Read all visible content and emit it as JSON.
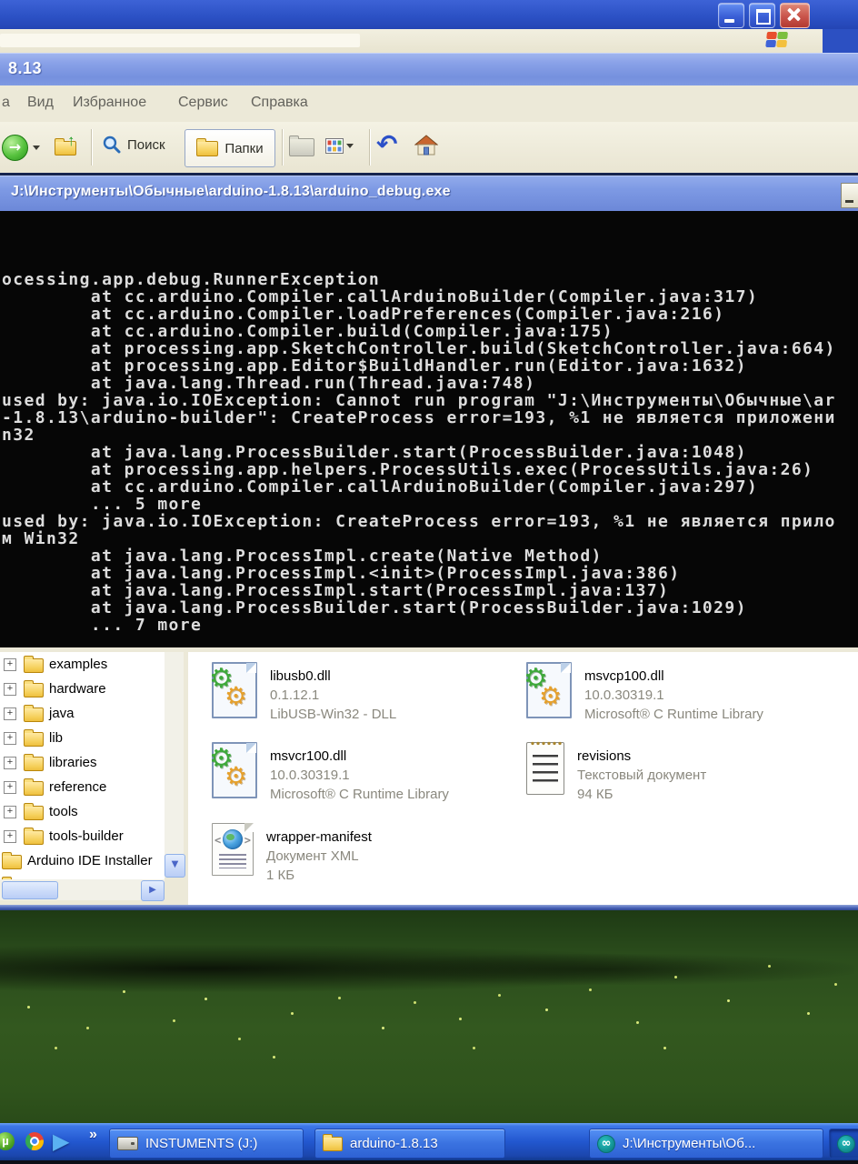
{
  "inner_window": {
    "title_fragment": "8.13"
  },
  "menu": {
    "left_fragment": "а",
    "items": [
      "Вид",
      "Избранное",
      "Сервис",
      "Справка"
    ]
  },
  "toolbar": {
    "search": "Поиск",
    "folders": "Папки"
  },
  "console": {
    "title": "J:\\Инструменты\\Обычные\\arduino-1.8.13\\arduino_debug.exe",
    "lines": [
      "ocessing.app.debug.RunnerException",
      "        at cc.arduino.Compiler.callArduinoBuilder(Compiler.java:317)",
      "        at cc.arduino.Compiler.loadPreferences(Compiler.java:216)",
      "        at cc.arduino.Compiler.build(Compiler.java:175)",
      "        at processing.app.SketchController.build(SketchController.java:664)",
      "        at processing.app.Editor$BuildHandler.run(Editor.java:1632)",
      "        at java.lang.Thread.run(Thread.java:748)",
      "used by: java.io.IOException: Cannot run program \"J:\\Инструменты\\Обычные\\ar",
      "-1.8.13\\arduino-builder\": CreateProcess error=193, %1 не является приложени",
      "n32",
      "        at java.lang.ProcessBuilder.start(ProcessBuilder.java:1048)",
      "        at processing.app.helpers.ProcessUtils.exec(ProcessUtils.java:26)",
      "        at cc.arduino.Compiler.callArduinoBuilder(Compiler.java:297)",
      "        ... 5 more",
      "used by: java.io.IOException: CreateProcess error=193, %1 не является прило",
      "м Win32",
      "        at java.lang.ProcessImpl.create(Native Method)",
      "        at java.lang.ProcessImpl.<init>(ProcessImpl.java:386)",
      "        at java.lang.ProcessImpl.start(ProcessImpl.java:137)",
      "        at java.lang.ProcessBuilder.start(ProcessBuilder.java:1029)",
      "        ... 7 more"
    ]
  },
  "tree": {
    "items": [
      "examples",
      "hardware",
      "java",
      "lib",
      "libraries",
      "reference",
      "tools",
      "tools-builder",
      "Arduino IDE Installer"
    ]
  },
  "files": [
    {
      "name": "libusb0.dll",
      "line2": "0.1.12.1",
      "line3": "LibUSB-Win32 - DLL",
      "icon": "dll"
    },
    {
      "name": "msvcp100.dll",
      "line2": "10.0.30319.1",
      "line3": "Microsoft® C Runtime Library",
      "icon": "dll"
    },
    {
      "name": "msvcr100.dll",
      "line2": "10.0.30319.1",
      "line3": "Microsoft® C Runtime Library",
      "icon": "dll"
    },
    {
      "name": "revisions",
      "line2": "Текстовый документ",
      "line3": "94 КБ",
      "icon": "text"
    },
    {
      "name": "wrapper-manifest",
      "line2": "Документ XML",
      "line3": "1 КБ",
      "icon": "xml"
    }
  ],
  "taskbar": {
    "chevron": "»",
    "utorrent_glyph": "µ",
    "play_glyph": "▶",
    "arduino_glyph": "∞",
    "scroll_down_glyph": "▼",
    "scroll_right_glyph": "▶",
    "forward_glyph": "→",
    "undo_glyph": "↶",
    "buttons": [
      {
        "label": "INSTUMENTS (J:)",
        "icon": "drive"
      },
      {
        "label": "arduino-1.8.13",
        "icon": "folder"
      },
      {
        "label": "J:\\Инструменты\\Об...",
        "icon": "arduino"
      },
      {
        "label": "",
        "icon": "arduino"
      }
    ]
  },
  "colors": {
    "xp_title_blue": "#7d99e4",
    "xp_taskbar_blue": "#2257cf",
    "console_bg": "#060606",
    "console_text": "#dcdcdc",
    "arduino_teal": "#0f8b8d",
    "beige": "#ece9d8"
  }
}
